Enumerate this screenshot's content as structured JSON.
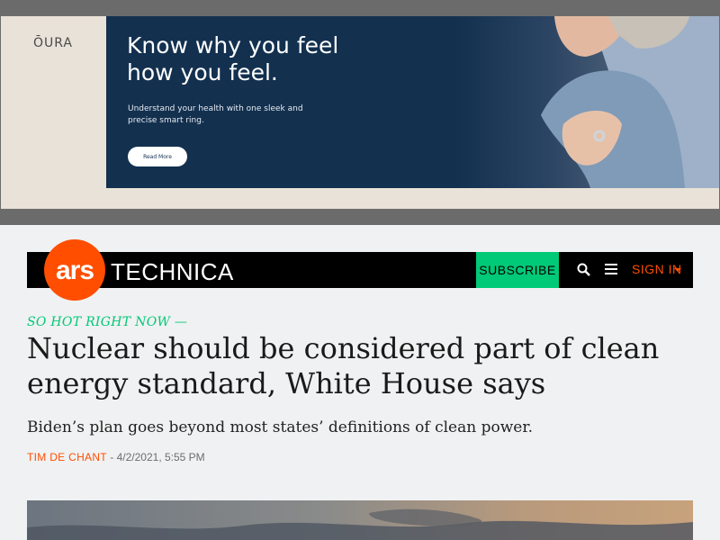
{
  "ad": {
    "brand": "ŌURA",
    "headline": "Know why you feel how you feel.",
    "body": "Understand your health with one sleek and precise smart ring.",
    "cta": "Read More",
    "colors": {
      "panel": "#13304f",
      "background": "#e9e2d8"
    }
  },
  "nav": {
    "logo_ars": "ars",
    "logo_technica": "TECHNICA",
    "subscribe": "SUBSCRIBE",
    "search_icon": "search-icon",
    "menu_icon": "hamburger-icon",
    "signin": "SIGN IN",
    "colors": {
      "brand": "#ff4e00",
      "subscribe": "#00c977"
    }
  },
  "article": {
    "kicker": "SO HOT RIGHT NOW —",
    "headline": "Nuclear should be considered part of clean energy standard, White House says",
    "dek": "Biden’s plan goes beyond most states’ definitions of clean power.",
    "author": "TIM DE CHANT",
    "separator": " - ",
    "date": "4/2/2021, 5:55 PM"
  }
}
